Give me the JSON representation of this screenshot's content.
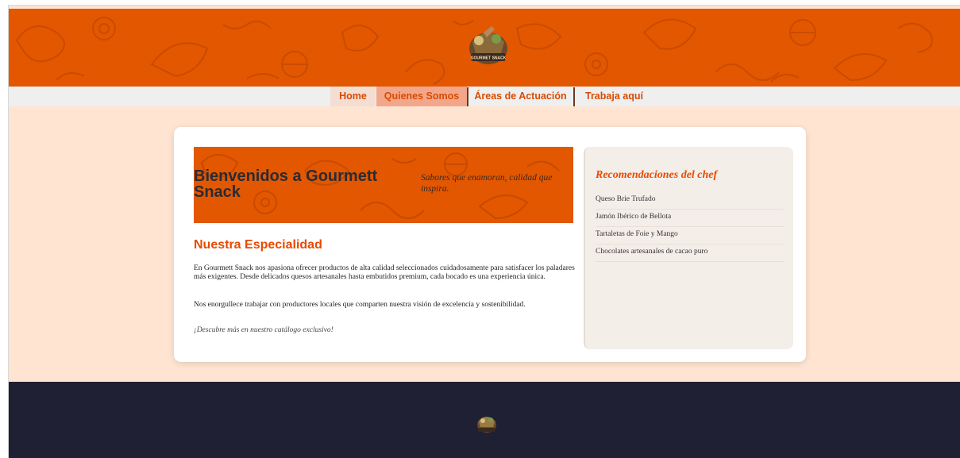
{
  "header": {
    "logo_text": "GOURMET SNACK",
    "colors": {
      "banner": "#e25700",
      "accent": "#e64a00",
      "footer": "#1f2033",
      "page": "#fee4d1"
    }
  },
  "nav": {
    "items": [
      {
        "label": "Home"
      },
      {
        "label": "Quienes Somos"
      },
      {
        "label": "Áreas de Actuación"
      },
      {
        "label": "Trabaja aquí"
      }
    ]
  },
  "hero": {
    "title": "Bienvenidos a Gourmett Snack",
    "tagline": "Sabores que enamoran, calidad que inspira."
  },
  "main": {
    "section_title": "Nuestra Especialidad",
    "paragraph1": "En Gourmett Snack nos apasiona ofrecer productos de alta calidad seleccionados cuidadosamente para satisfacer los paladares más exigentes. Desde delicados quesos artesanales hasta embutidos premium, cada bocado es una experiencia única.",
    "paragraph2": "Nos enorgullece trabajar con productores locales que comparten nuestra visión de excelencia y sostenibilidad.",
    "cta": "¡Descubre más en nuestro catálogo exclusivo!"
  },
  "sidebar": {
    "title": "Recomendaciones del chef",
    "items": [
      "Queso Brie Trufado",
      "Jamón Ibérico de Bellota",
      "Tartaletas de Foie y Mango",
      "Chocolates artesanales de cacao puro"
    ]
  }
}
